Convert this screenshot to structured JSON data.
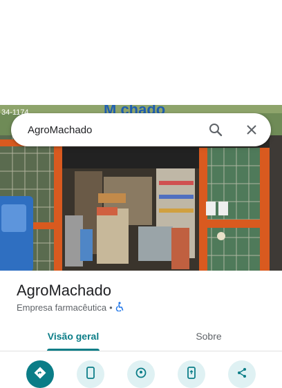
{
  "search": {
    "query": "AgroMachado"
  },
  "place": {
    "name": "AgroMachado",
    "category": "Empresa farmacêutica",
    "separator": "•"
  },
  "tabs": [
    {
      "label": "Visão geral",
      "active": true
    },
    {
      "label": "Sobre",
      "active": false
    }
  ],
  "actions": [
    {
      "icon": "directions-icon"
    },
    {
      "icon": "phone-icon"
    },
    {
      "icon": "save-location-icon"
    },
    {
      "icon": "send-to-phone-icon"
    },
    {
      "icon": "share-icon"
    }
  ],
  "photo_sign": {
    "phone_fragment": "34-1174",
    "brand_fragment": "M chado"
  },
  "colors": {
    "accent": "#0b7d87",
    "accent_light": "#dff1f3",
    "accessibility": "#1a73e8"
  }
}
